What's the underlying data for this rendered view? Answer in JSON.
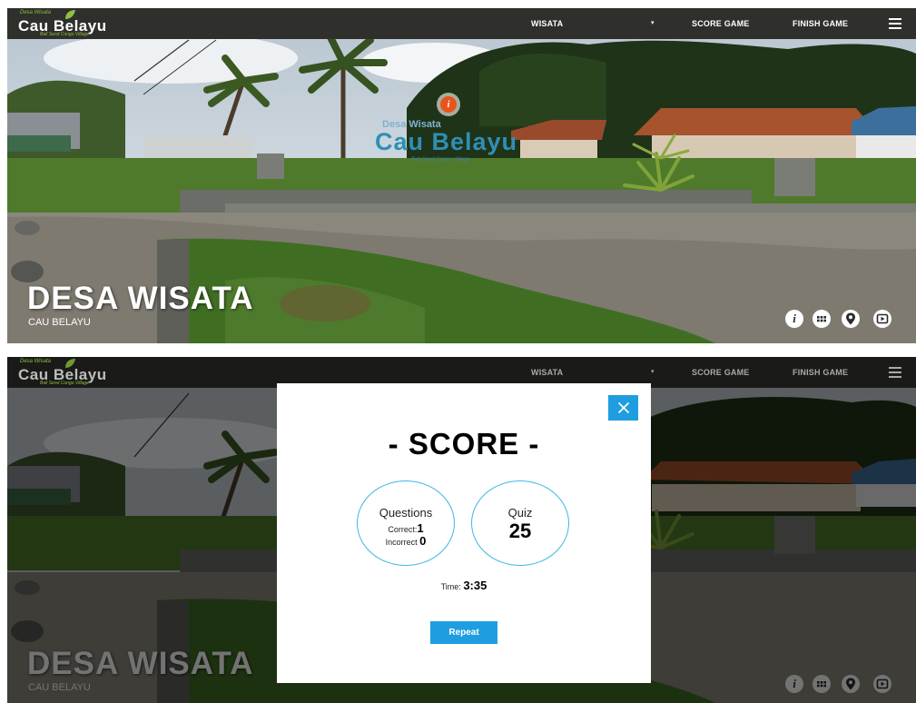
{
  "colors": {
    "accent": "#1e9ee0",
    "navbar": "#2f2f2b",
    "circle_border": "#3fb6e2",
    "hotspot": "#e8541c"
  },
  "logo": {
    "small": "Desa Wisata",
    "name": "Cau Belayu",
    "tagline": "Bali Send Congo Village"
  },
  "nav": {
    "wisata": "WISATA",
    "caret": "▾",
    "score_game": "SCORE GAME",
    "finish_game": "FINISH GAME",
    "menu_icon": "hamburger-icon"
  },
  "hero": {
    "title": "DESA WISATA",
    "subtitle": "CAU BELAYU"
  },
  "controls": [
    "info-icon",
    "grid-icon",
    "map-pin-icon",
    "play-icon"
  ],
  "scene_sign": {
    "small": "Desa Wisata",
    "name": "Cau Belayu",
    "tagline": "Bali Send Congo Village",
    "hotspot_icon": "info-icon"
  },
  "score_modal": {
    "title": "- SCORE -",
    "close_icon": "close-icon",
    "questions_label": "Questions",
    "correct_label": "Correct:",
    "correct_value": "1",
    "incorrect_label": "Incorrect",
    "incorrect_value": "0",
    "quiz_label": "Quiz",
    "quiz_value": "25",
    "time_label": "Time:",
    "time_value": "3:35",
    "repeat_label": "Repeat"
  }
}
